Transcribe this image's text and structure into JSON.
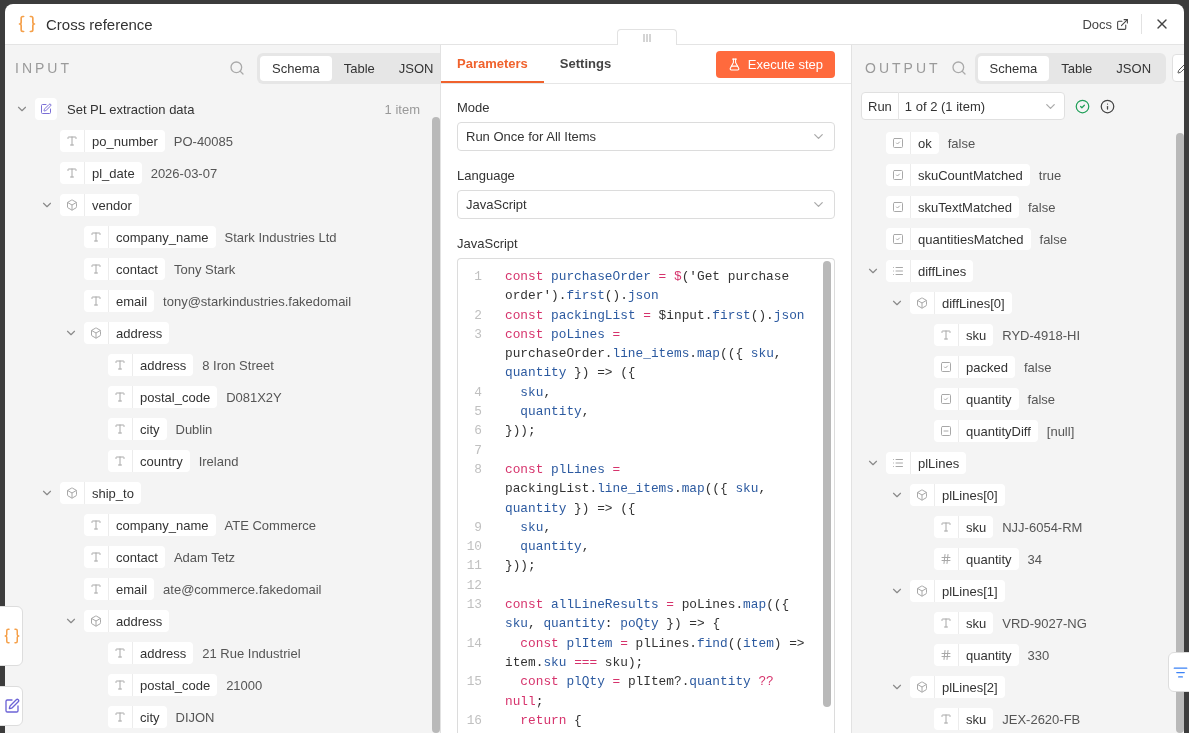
{
  "dialog": {
    "title": "Cross reference",
    "docs_link": "Docs"
  },
  "input": {
    "heading": "INPUT",
    "view_tabs": [
      {
        "label": "Schema",
        "selected": true
      },
      {
        "label": "Table",
        "selected": false
      },
      {
        "label": "JSON",
        "selected": false
      }
    ],
    "source": {
      "name": "Set PL extraction data",
      "count": "1 item",
      "expanded": true
    },
    "fields": [
      {
        "kind": "string",
        "key": "po_number",
        "value": "PO-40085"
      },
      {
        "kind": "string",
        "key": "pl_date",
        "value": "2026-03-07"
      },
      {
        "kind": "object",
        "key": "vendor",
        "expanded": true,
        "children": [
          {
            "kind": "string",
            "key": "company_name",
            "value": "Stark Industries Ltd"
          },
          {
            "kind": "string",
            "key": "contact",
            "value": "Tony Stark"
          },
          {
            "kind": "string",
            "key": "email",
            "value": "tony@starkindustries.fakedomail"
          },
          {
            "kind": "object",
            "key": "address",
            "expanded": true,
            "children": [
              {
                "kind": "string",
                "key": "address",
                "value": "8 Iron Street"
              },
              {
                "kind": "string",
                "key": "postal_code",
                "value": "D081X2Y"
              },
              {
                "kind": "string",
                "key": "city",
                "value": "Dublin"
              },
              {
                "kind": "string",
                "key": "country",
                "value": "Ireland"
              }
            ]
          }
        ]
      },
      {
        "kind": "object",
        "key": "ship_to",
        "expanded": true,
        "children": [
          {
            "kind": "string",
            "key": "company_name",
            "value": "ATE Commerce"
          },
          {
            "kind": "string",
            "key": "contact",
            "value": "Adam Tetz"
          },
          {
            "kind": "string",
            "key": "email",
            "value": "ate@commerce.fakedomail"
          },
          {
            "kind": "object",
            "key": "address",
            "expanded": true,
            "children": [
              {
                "kind": "string",
                "key": "address",
                "value": "21 Rue Industriel"
              },
              {
                "kind": "string",
                "key": "postal_code",
                "value": "21000"
              },
              {
                "kind": "string",
                "key": "city",
                "value": "DIJON"
              }
            ]
          }
        ]
      }
    ]
  },
  "parameters": {
    "tabs": [
      {
        "label": "Parameters",
        "selected": true
      },
      {
        "label": "Settings",
        "selected": false
      }
    ],
    "execute_button": "Execute step",
    "mode": {
      "label": "Mode",
      "value": "Run Once for All Items"
    },
    "language": {
      "label": "Language",
      "value": "JavaScript"
    },
    "code": {
      "label": "JavaScript",
      "lines": [
        {
          "number": "1",
          "tokens": [
            {
              "kind": "keyword",
              "text": "const"
            },
            {
              "kind": "name",
              "text": " purchaseOrder"
            },
            {
              "kind": "operator",
              "text": " ="
            },
            {
              "kind": "operator",
              "text": " $"
            },
            {
              "kind": "plain",
              "text": "('Get purchase order')."
            },
            {
              "kind": "name",
              "text": "first"
            },
            {
              "kind": "plain",
              "text": "()."
            },
            {
              "kind": "name",
              "text": "json"
            }
          ]
        },
        {
          "number": "2",
          "tokens": [
            {
              "kind": "keyword",
              "text": "const"
            },
            {
              "kind": "name",
              "text": " packingList"
            },
            {
              "kind": "operator",
              "text": " ="
            },
            {
              "kind": "plain",
              "text": " $input."
            },
            {
              "kind": "name",
              "text": "first"
            },
            {
              "kind": "plain",
              "text": "()."
            },
            {
              "kind": "name",
              "text": "json"
            }
          ]
        },
        {
          "number": "3",
          "tokens": [
            {
              "kind": "keyword",
              "text": "const"
            },
            {
              "kind": "name",
              "text": " poLines"
            },
            {
              "kind": "operator",
              "text": " ="
            },
            {
              "kind": "plain",
              "text": " purchaseOrder."
            },
            {
              "kind": "name",
              "text": "line_items"
            },
            {
              "kind": "plain",
              "text": "."
            },
            {
              "kind": "name",
              "text": "map"
            },
            {
              "kind": "plain",
              "text": "(({"
            },
            {
              "kind": "name",
              "text": " sku"
            },
            {
              "kind": "plain",
              "text": ","
            },
            {
              "kind": "name",
              "text": " quantity"
            },
            {
              "kind": "plain",
              "text": " }) => ({"
            }
          ]
        },
        {
          "number": "4",
          "tokens": [
            {
              "kind": "name",
              "text": "  sku"
            },
            {
              "kind": "plain",
              "text": ","
            }
          ]
        },
        {
          "number": "5",
          "tokens": [
            {
              "kind": "name",
              "text": "  quantity"
            },
            {
              "kind": "plain",
              "text": ","
            }
          ]
        },
        {
          "number": "6",
          "tokens": [
            {
              "kind": "plain",
              "text": "}));"
            }
          ]
        },
        {
          "number": "7"
        },
        {
          "number": "8",
          "tokens": [
            {
              "kind": "keyword",
              "text": "const"
            },
            {
              "kind": "name",
              "text": " plLines"
            },
            {
              "kind": "operator",
              "text": " ="
            },
            {
              "kind": "plain",
              "text": " packingList."
            },
            {
              "kind": "name",
              "text": "line_items"
            },
            {
              "kind": "plain",
              "text": "."
            },
            {
              "kind": "name",
              "text": "map"
            },
            {
              "kind": "plain",
              "text": "(({"
            },
            {
              "kind": "name",
              "text": " sku"
            },
            {
              "kind": "plain",
              "text": ","
            },
            {
              "kind": "name",
              "text": " quantity"
            },
            {
              "kind": "plain",
              "text": " }) => ({"
            }
          ]
        },
        {
          "number": "9",
          "tokens": [
            {
              "kind": "name",
              "text": "  sku"
            },
            {
              "kind": "plain",
              "text": ","
            }
          ]
        },
        {
          "number": "10",
          "tokens": [
            {
              "kind": "name",
              "text": "  quantity"
            },
            {
              "kind": "plain",
              "text": ","
            }
          ]
        },
        {
          "number": "11",
          "tokens": [
            {
              "kind": "plain",
              "text": "}));"
            }
          ]
        },
        {
          "number": "12"
        },
        {
          "number": "13",
          "tokens": [
            {
              "kind": "keyword",
              "text": "const"
            },
            {
              "kind": "name",
              "text": " allLineResults"
            },
            {
              "kind": "operator",
              "text": " ="
            },
            {
              "kind": "plain",
              "text": " poLines."
            },
            {
              "kind": "name",
              "text": "map"
            },
            {
              "kind": "plain",
              "text": "(({"
            },
            {
              "kind": "name",
              "text": " sku"
            },
            {
              "kind": "plain",
              "text": ","
            },
            {
              "kind": "name",
              "text": " quantity"
            },
            {
              "kind": "plain",
              "text": ":"
            },
            {
              "kind": "name",
              "text": " poQty"
            },
            {
              "kind": "plain",
              "text": " }) => {"
            }
          ]
        },
        {
          "number": "14",
          "tokens": [
            {
              "kind": "keyword",
              "text": "  const"
            },
            {
              "kind": "name",
              "text": " plItem"
            },
            {
              "kind": "operator",
              "text": " ="
            },
            {
              "kind": "plain",
              "text": " plLines."
            },
            {
              "kind": "name",
              "text": "find"
            },
            {
              "kind": "plain",
              "text": "(("
            },
            {
              "kind": "name",
              "text": "item"
            },
            {
              "kind": "plain",
              "text": ") => item."
            },
            {
              "kind": "name",
              "text": "sku"
            },
            {
              "kind": "operator",
              "text": " ==="
            },
            {
              "kind": "plain",
              "text": " sku);"
            }
          ]
        },
        {
          "number": "15",
          "tokens": [
            {
              "kind": "keyword",
              "text": "  const"
            },
            {
              "kind": "name",
              "text": " plQty"
            },
            {
              "kind": "operator",
              "text": " ="
            },
            {
              "kind": "plain",
              "text": " plItem?."
            },
            {
              "kind": "name",
              "text": "quantity"
            },
            {
              "kind": "operator",
              "text": " ??"
            },
            {
              "kind": "keyword",
              "text": " null"
            },
            {
              "kind": "plain",
              "text": ";"
            }
          ]
        },
        {
          "number": "16",
          "tokens": [
            {
              "kind": "keyword",
              "text": "  return"
            },
            {
              "kind": "plain",
              "text": " {"
            }
          ]
        }
      ]
    }
  },
  "output": {
    "heading": "OUTPUT",
    "view_tabs": [
      {
        "label": "Schema",
        "selected": true
      },
      {
        "label": "Table",
        "selected": false
      },
      {
        "label": "JSON",
        "selected": false
      }
    ],
    "run": {
      "label": "Run",
      "value": "1 of 2 (1 item)"
    },
    "fields": [
      {
        "kind": "boolean",
        "key": "ok",
        "value": "false"
      },
      {
        "kind": "boolean",
        "key": "skuCountMatched",
        "value": "true"
      },
      {
        "kind": "boolean",
        "key": "skuTextMatched",
        "value": "false"
      },
      {
        "kind": "boolean",
        "key": "quantitiesMatched",
        "value": "false"
      },
      {
        "kind": "array",
        "key": "diffLines",
        "expanded": true,
        "children": [
          {
            "kind": "object",
            "key": "diffLines[0]",
            "expanded": true,
            "children": [
              {
                "kind": "string",
                "key": "sku",
                "value": "RYD-4918-HI"
              },
              {
                "kind": "boolean",
                "key": "packed",
                "value": "false"
              },
              {
                "kind": "boolean",
                "key": "quantity",
                "value": "false"
              },
              {
                "kind": "null",
                "key": "quantityDiff",
                "value": "[null]"
              }
            ]
          }
        ]
      },
      {
        "kind": "array",
        "key": "plLines",
        "expanded": true,
        "children": [
          {
            "kind": "object",
            "key": "plLines[0]",
            "expanded": true,
            "children": [
              {
                "kind": "string",
                "key": "sku",
                "value": "NJJ-6054-RM"
              },
              {
                "kind": "number",
                "key": "quantity",
                "value": "34"
              }
            ]
          },
          {
            "kind": "object",
            "key": "plLines[1]",
            "expanded": true,
            "children": [
              {
                "kind": "string",
                "key": "sku",
                "value": "VRD-9027-NG"
              },
              {
                "kind": "number",
                "key": "quantity",
                "value": "330"
              }
            ]
          },
          {
            "kind": "object",
            "key": "plLines[2]",
            "expanded": true,
            "children": [
              {
                "kind": "string",
                "key": "sku",
                "value": "JEX-2620-FB"
              }
            ]
          }
        ]
      }
    ]
  }
}
